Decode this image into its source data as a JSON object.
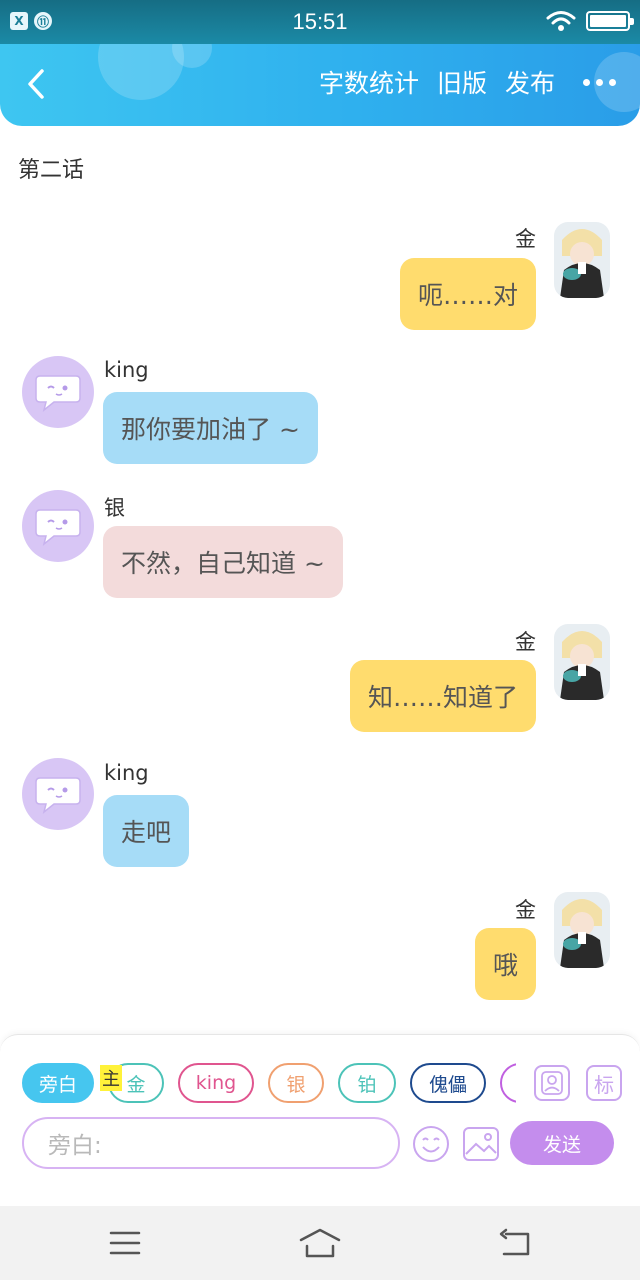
{
  "status_bar": {
    "time": "15:51",
    "left_icons": [
      "X",
      "⑪"
    ]
  },
  "header": {
    "actions": [
      "字数统计",
      "旧版",
      "发布"
    ]
  },
  "chapter_title": "第二话",
  "messages": [
    {
      "side": "right",
      "name": "金",
      "text": "呃……对",
      "color": "#ffdc6e"
    },
    {
      "side": "left",
      "name": "king",
      "text": "那你要加油了 ~",
      "color": "#a6dcf7"
    },
    {
      "side": "left",
      "name": "银",
      "text": "不然，自己知道 ~",
      "color": "#f3dbdb"
    },
    {
      "side": "right",
      "name": "金",
      "text": "知……知道了",
      "color": "#ffdc6e"
    },
    {
      "side": "left",
      "name": "king",
      "text": "走吧",
      "color": "#a6dcf7"
    },
    {
      "side": "right",
      "name": "金",
      "text": "哦",
      "color": "#ffdc6e"
    }
  ],
  "composer": {
    "main_tag": "主",
    "roles": [
      {
        "label": "旁白",
        "color": "#46c6ef",
        "active": true
      },
      {
        "label": "金",
        "color": "#4cc3b8"
      },
      {
        "label": "king",
        "color": "#e0558f"
      },
      {
        "label": "银",
        "color": "#f0a070"
      },
      {
        "label": "铂",
        "color": "#4cc3b8"
      },
      {
        "label": "傀儡",
        "color": "#1e4a8e"
      }
    ],
    "mark_label": "标",
    "input_placeholder": "旁白:",
    "send_label": "发送"
  }
}
